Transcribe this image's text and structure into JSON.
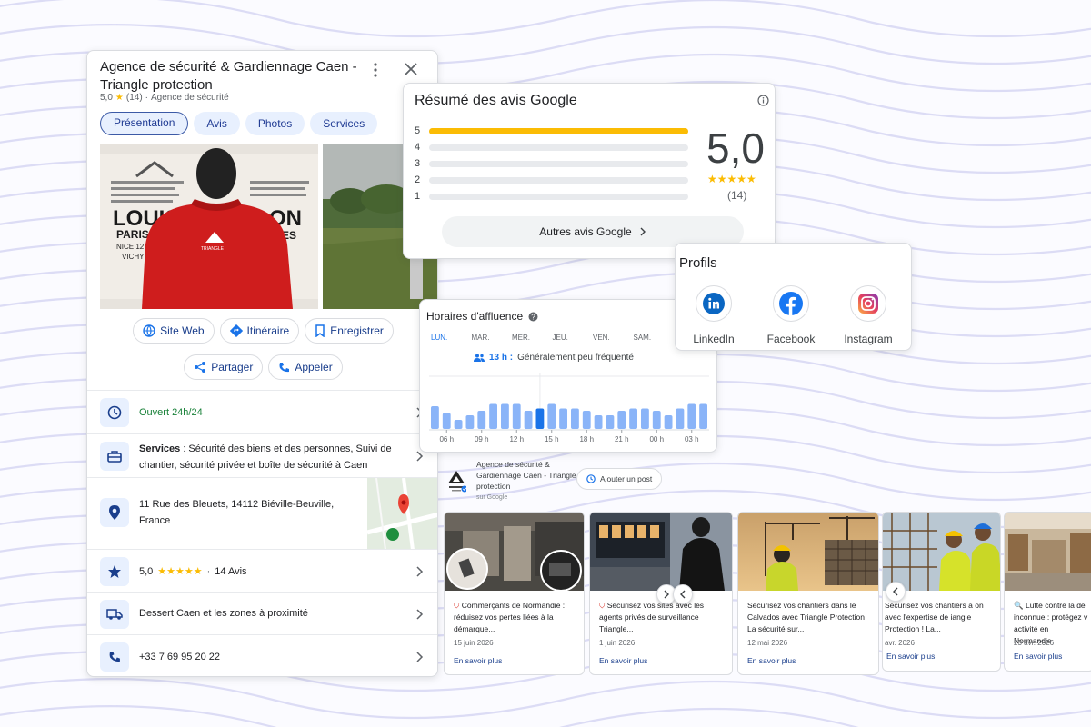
{
  "business": {
    "name": "Agence de sécurité & Gardiennage Caen - Triangle protection",
    "rating": "5,0",
    "stars": "★",
    "review_count": "(14)",
    "separator": "·",
    "category": "Agence de sécurité"
  },
  "tabs": [
    {
      "label": "Présentation",
      "active": true
    },
    {
      "label": "Avis"
    },
    {
      "label": "Photos"
    },
    {
      "label": "Services"
    }
  ],
  "actions": {
    "website": "Site Web",
    "directions": "Itinéraire",
    "save": "Enregistrer",
    "share": "Partager",
    "call": "Appeler"
  },
  "photo_text": {
    "poster_big_1": "LOUIS",
    "poster_big_2": "ON",
    "poster_line": "PARIS 70",
    "poster_line2": "NICE 12 AV DE",
    "poster_line3": "VICHY RUE D",
    "poster_right": "EES",
    "jacket_logo": "TRIANGLE"
  },
  "info": {
    "hours": "Ouvert 24h/24",
    "services_label": "Services",
    "services_text": " : Sécurité des biens et des personnes, Suivi de chantier, sécurité privée et boîte de sécurité à Caen",
    "address": "11 Rue des Bleuets, 14112 Biéville-Beuville, France",
    "rating_value": "5,0",
    "rating_stars": "★★★★★",
    "rating_sep": "·",
    "rating_count": "14 Avis",
    "area": "Dessert Caen et les zones à proximité",
    "phone": "+33 7 69 95 20 22"
  },
  "reviews_summary": {
    "title": "Résumé des avis Google",
    "score": "5,0",
    "stars": "★★★★★",
    "count": "(14)",
    "more_button": "Autres avis Google",
    "distribution": [
      {
        "star": "5",
        "fraction": 1.0
      },
      {
        "star": "4",
        "fraction": 0
      },
      {
        "star": "3",
        "fraction": 0
      },
      {
        "star": "2",
        "fraction": 0
      },
      {
        "star": "1",
        "fraction": 0
      }
    ]
  },
  "profiles": {
    "title": "Profils",
    "items": [
      {
        "label": "LinkedIn",
        "icon": "linkedin-icon",
        "color": "#0a66c2"
      },
      {
        "label": "Facebook",
        "icon": "facebook-icon",
        "color": "#1877f2"
      },
      {
        "label": "Instagram",
        "icon": "instagram-icon",
        "color": "#d6249f"
      }
    ]
  },
  "popular_times": {
    "title": "Horaires d'affluence",
    "days": [
      "LUN.",
      "MAR.",
      "MER.",
      "JEU.",
      "VEN.",
      "SAM."
    ],
    "active_day": "LUN.",
    "highlight_hour": "13 h :",
    "highlight_text": "Généralement peu fréquenté",
    "hour_labels": [
      "06 h",
      "09 h",
      "12 h",
      "15 h",
      "18 h",
      "21 h",
      "00 h",
      "03 h"
    ],
    "bar_color": "#8ab4f8",
    "current_bar_color": "#1a73e8",
    "busyness": [
      0.5,
      0.35,
      0.2,
      0.3,
      0.4,
      0.55,
      0.55,
      0.55,
      0.4,
      0.45,
      0.55,
      0.45,
      0.45,
      0.4,
      0.3,
      0.3,
      0.4,
      0.45,
      0.45,
      0.4,
      0.3,
      0.45,
      0.55,
      0.55
    ],
    "current_index": 9
  },
  "posts": {
    "author": "Agence de sécurité & Gardiennage Caen - Triangle protection",
    "source": "sur Google",
    "add_post": "Ajouter un post",
    "read_more": "En savoir plus",
    "items": [
      {
        "text": "Commerçants de Normandie : réduisez vos pertes liées à la démarque...",
        "date": "15 juin 2026"
      },
      {
        "text": "Sécurisez vos sites avec les agents privés de surveillance Triangle...",
        "date": "1 juin 2026"
      },
      {
        "text": "Sécurisez vos chantiers dans le Calvados avec Triangle Protection La sécurité sur...",
        "date": "12 mai 2026"
      },
      {
        "text": "Sécurisez vos chantiers à on avec l'expertise de iangle Protection ! La...",
        "date": "avr. 2026"
      },
      {
        "text": "Lutte contre la dé inconnue : protégez v activité en Normandie",
        "date": "23 avr. 2026"
      }
    ]
  }
}
